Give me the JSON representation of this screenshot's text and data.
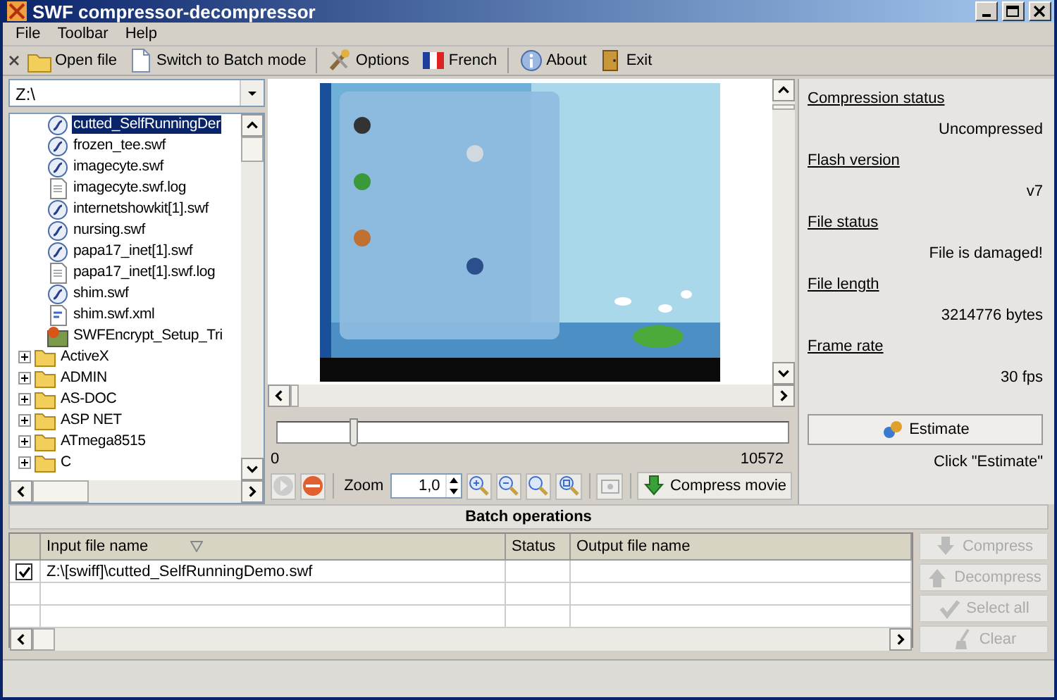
{
  "window": {
    "title": "SWF compressor-decompressor"
  },
  "menu": [
    "File",
    "Toolbar",
    "Help"
  ],
  "toolbar": [
    {
      "label": "Open file",
      "kind": "folder"
    },
    {
      "label": "Switch to Batch mode",
      "kind": "page"
    },
    {
      "label": "Options",
      "kind": "tools"
    },
    {
      "label": "French",
      "kind": "flag"
    },
    {
      "label": "About",
      "kind": "info"
    },
    {
      "label": "Exit",
      "kind": "door"
    }
  ],
  "drive": {
    "value": "Z:\\"
  },
  "tree": {
    "items": [
      {
        "label": "cutted_SelfRunningDer",
        "kind": "swf",
        "selected": true
      },
      {
        "label": "frozen_tee.swf",
        "kind": "swf",
        "selected": false
      },
      {
        "label": "imagecyte.swf",
        "kind": "swf",
        "selected": false
      },
      {
        "label": "imagecyte.swf.log",
        "kind": "log",
        "selected": false
      },
      {
        "label": "internetshowkit[1].swf",
        "kind": "swf",
        "selected": false
      },
      {
        "label": "nursing.swf",
        "kind": "swf",
        "selected": false
      },
      {
        "label": "papa17_inet[1].swf",
        "kind": "swf",
        "selected": false
      },
      {
        "label": "papa17_inet[1].swf.log",
        "kind": "log",
        "selected": false
      },
      {
        "label": "shim.swf",
        "kind": "swf",
        "selected": false
      },
      {
        "label": "shim.swf.xml",
        "kind": "xml",
        "selected": false
      },
      {
        "label": "SWFEncrypt_Setup_Tri",
        "kind": "exe",
        "selected": false
      },
      {
        "label": "ActiveX",
        "kind": "folder",
        "selected": false
      },
      {
        "label": "ADMIN",
        "kind": "folder",
        "selected": false
      },
      {
        "label": "AS-DOC",
        "kind": "folder",
        "selected": false
      },
      {
        "label": "ASP NET",
        "kind": "folder",
        "selected": false
      },
      {
        "label": "ATmega8515",
        "kind": "folder",
        "selected": false
      },
      {
        "label": "C",
        "kind": "folder",
        "selected": false
      }
    ]
  },
  "preview": {
    "slider": {
      "level": 0.15
    },
    "start": "0",
    "end": "10572",
    "zoom_label": "Zoom",
    "zoom_value": "1,0",
    "compress_button": "Compress movie"
  },
  "info": {
    "fields": [
      {
        "label": "Compression status",
        "value": "Uncompressed"
      },
      {
        "label": "Flash version",
        "value": "v7"
      },
      {
        "label": "File status",
        "value": "File is damaged!"
      },
      {
        "label": "File length",
        "value": "3214776 bytes"
      },
      {
        "label": "Frame rate",
        "value": "30 fps"
      }
    ],
    "estimate_button": "Estimate",
    "hint": "Click \"Estimate\""
  },
  "batch": {
    "title": "Batch operations",
    "columns": [
      "Input file name",
      "Status",
      "Output file name"
    ],
    "rows": [
      {
        "checked": true,
        "input": "Z:\\[swiff]\\cutted_SelfRunningDemo.swf"
      }
    ],
    "buttons": [
      {
        "label": "Compress",
        "kind": "down",
        "disabled": true
      },
      {
        "label": "Decompress",
        "kind": "up",
        "disabled": true
      },
      {
        "label": "Select all",
        "kind": "check",
        "disabled": true
      },
      {
        "label": "Clear",
        "kind": "broom",
        "disabled": true
      }
    ]
  }
}
